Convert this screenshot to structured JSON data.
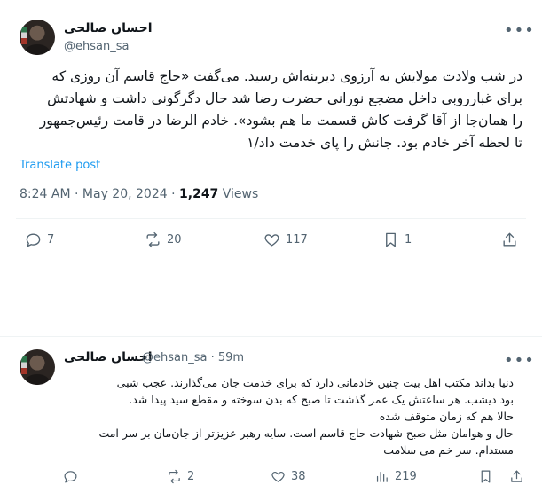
{
  "post1": {
    "author_name": "احسان صالحی",
    "author_handle": "@ehsan_sa",
    "text_lines": [
      "در شب ولادت مولایش به آرزوی دیرینه‌اش رسید. می‌گفت «حاج قاسم آن روزی که",
      "برای غبارروبی داخل مضجع نورانی حضرت رضا شد حال دگرگونی داشت و شهادتش",
      "را همان‌جا از آقا گرفت کاش قسمت ما هم بشود». خادم الرضا در قامت رئیس‌جمهور",
      "تا لحظه آخر خادم بود. جانش را پای خدمت داد/۱"
    ],
    "translate_label": "Translate post",
    "time": "8:24 AM",
    "separator": "·",
    "date": "May 20, 2024",
    "views_count": "1,247",
    "views_label": "Views",
    "actions": {
      "replies": "7",
      "reposts": "20",
      "likes": "117",
      "bookmarks": "1"
    },
    "more_label": "•••"
  },
  "post2": {
    "author_name": "احسان صالحی",
    "author_handle": "@ehsan_sa · 59m",
    "text_lines": [
      "دنیا بداند مکتب اهل بیت چنین خادمانی دارد که برای خدمت جان می‌گذارند. عجب شبی",
      "بود دیشب. هر ساعتش یک عمر گذشت تا صبح که بدن سوخته و مقطع سید پیدا شد.",
      "حالا هم که زمان متوقف شده",
      "حال و هوامان مثل صبح شهادت حاج قاسم است. سایه رهبر عزیزتر از جان‌مان بر سر امت",
      "مستدام. سر خم می سلامت"
    ],
    "actions": {
      "reposts": "2",
      "likes": "38",
      "views": "219"
    },
    "more_label": "•••"
  },
  "icons": {
    "reply": "reply-icon",
    "repost": "repost-icon",
    "like": "heart-icon",
    "bookmark": "bookmark-icon",
    "share": "share-icon",
    "views": "views-bar-icon",
    "more": "more-dots-icon"
  },
  "colors": {
    "text_primary": "#0f1419",
    "text_secondary": "#536471",
    "link": "#1d9bf0",
    "divider": "#eff3f4"
  }
}
